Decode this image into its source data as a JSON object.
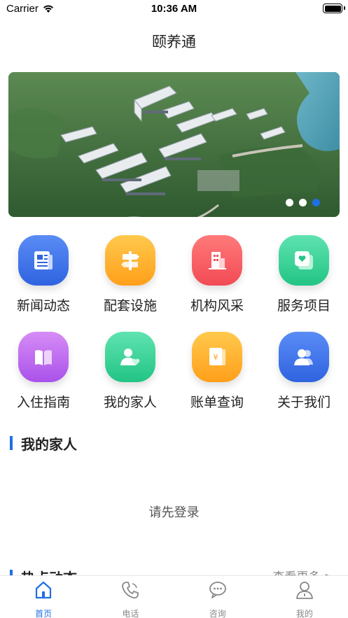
{
  "status_bar": {
    "carrier": "Carrier",
    "time": "10:36 AM"
  },
  "nav": {
    "title": "颐养通"
  },
  "banner": {
    "page_count": 3,
    "active_index": 2
  },
  "menu": [
    {
      "label": "新闻动态",
      "icon": "news-icon",
      "color_from": "#5a8cf5",
      "color_to": "#2f63e0"
    },
    {
      "label": "配套设施",
      "icon": "signpost-icon",
      "color_from": "#ffc94d",
      "color_to": "#ff9f1a"
    },
    {
      "label": "机构风采",
      "icon": "building-icon",
      "color_from": "#ff7a7a",
      "color_to": "#f24a55"
    },
    {
      "label": "服务项目",
      "icon": "service-icon",
      "color_from": "#5fe3b0",
      "color_to": "#22c485"
    },
    {
      "label": "入住指南",
      "icon": "book-icon",
      "color_from": "#d68cf5",
      "color_to": "#a952ea"
    },
    {
      "label": "我的家人",
      "icon": "family-icon",
      "color_from": "#5fe3b0",
      "color_to": "#22c485"
    },
    {
      "label": "账单查询",
      "icon": "bill-icon",
      "color_from": "#ffc94d",
      "color_to": "#ff9f1a"
    },
    {
      "label": "关于我们",
      "icon": "about-icon",
      "color_from": "#5a8cf5",
      "color_to": "#2f63e0"
    }
  ],
  "family_section": {
    "title": "我的家人",
    "empty_text": "请先登录"
  },
  "news_section": {
    "title": "热点动态",
    "more": "查看更多 >"
  },
  "tabs": [
    {
      "label": "首页",
      "icon": "home-icon",
      "active": true
    },
    {
      "label": "电话",
      "icon": "phone-icon",
      "active": false
    },
    {
      "label": "咨询",
      "icon": "chat-icon",
      "active": false
    },
    {
      "label": "我的",
      "icon": "user-icon",
      "active": false
    }
  ],
  "colors": {
    "accent": "#1f6fe5",
    "text": "#222222",
    "muted": "#888888"
  }
}
